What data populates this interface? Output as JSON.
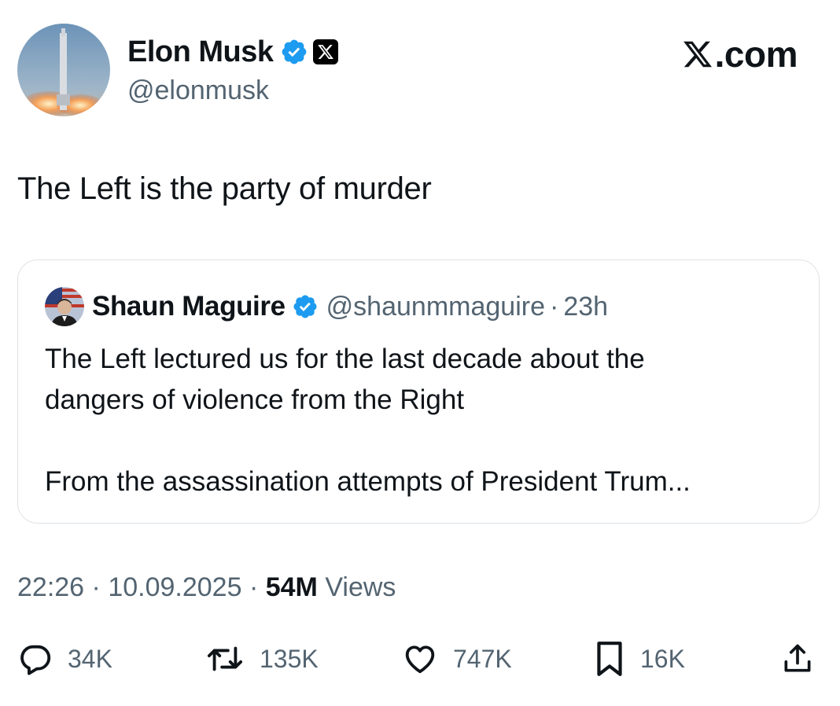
{
  "author": {
    "display_name": "Elon Musk",
    "handle": "@elonmusk",
    "verified_badge_icon": "verified-badge-icon",
    "affiliate_icon": "x-logo-icon"
  },
  "brand": {
    "label": ".com",
    "icon": "x-logo-icon"
  },
  "tweet": {
    "text": "The Left is the party of murder"
  },
  "quote": {
    "display_name": "Shaun Maguire",
    "handle": "@shaunmmaguire",
    "separator": "·",
    "time": "23h",
    "line1": "The Left lectured us for the last decade about the",
    "line2": "dangers of violence from the Right",
    "line3": "From the assassination attempts of President Trum..."
  },
  "meta": {
    "time": "22:26",
    "separator": "·",
    "date": "10.09.2025",
    "views_count": "54M",
    "views_label": "Views"
  },
  "actions": {
    "replies": "34K",
    "reposts": "135K",
    "likes": "747K",
    "bookmarks": "16K"
  },
  "colors": {
    "verified_blue": "#1d9bf0",
    "secondary_text": "#536471",
    "primary_text": "#0f1419"
  }
}
